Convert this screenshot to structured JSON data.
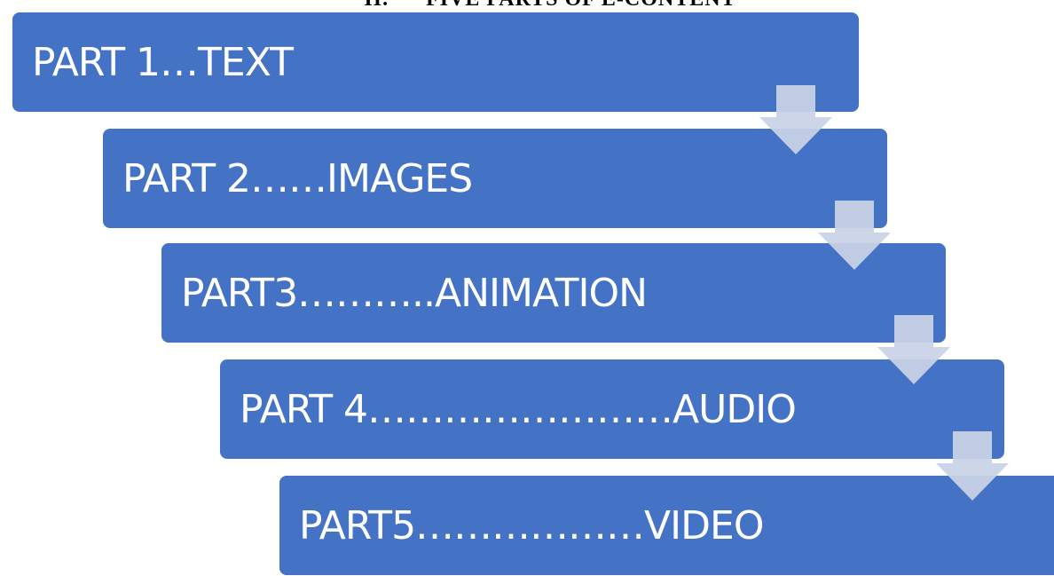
{
  "heading": "II.      FIVE PARTS OF E-CONTENT",
  "steps": [
    {
      "label": "PART 1…TEXT"
    },
    {
      "label": "PART 2……IMAGES"
    },
    {
      "label": "PART3………..ANIMATION"
    },
    {
      "label": "PART 4……………………AUDIO"
    },
    {
      "label": "PART5………………VIDEO"
    }
  ],
  "colors": {
    "step_fill": "#4472c4",
    "arrow_fill": "#c9d2e6"
  }
}
